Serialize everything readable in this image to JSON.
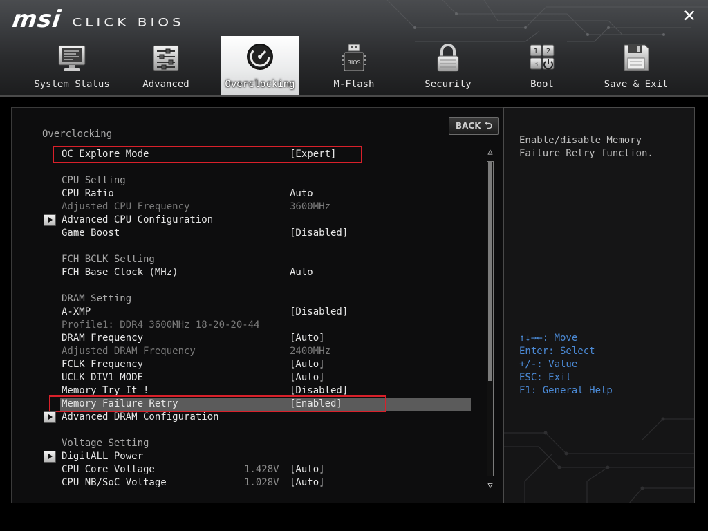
{
  "app": {
    "brand": "msi",
    "product": "CLICK BIOS"
  },
  "close_label": "✕",
  "tabs": [
    {
      "label": "System Status",
      "icon": "monitor-icon"
    },
    {
      "label": "Advanced",
      "icon": "sliders-icon"
    },
    {
      "label": "Overclocking",
      "icon": "gauge-icon",
      "active": true
    },
    {
      "label": "M-Flash",
      "icon": "bios-chip-icon"
    },
    {
      "label": "Security",
      "icon": "padlock-icon"
    },
    {
      "label": "Boot",
      "icon": "boot-order-icon"
    },
    {
      "label": "Save & Exit",
      "icon": "floppy-disk-icon"
    }
  ],
  "main": {
    "title": "Overclocking",
    "back_label": "BACK",
    "rows": {
      "oc_explore_mode": {
        "label": "OC Explore Mode",
        "value": "[Expert]"
      },
      "cpu_setting": {
        "label": "CPU Setting"
      },
      "cpu_ratio": {
        "label": "CPU Ratio",
        "value": "Auto"
      },
      "adjusted_cpu_frequency": {
        "label": "Adjusted CPU Frequency",
        "value": "3600MHz"
      },
      "advanced_cpu_configuration": {
        "label": "Advanced CPU Configuration"
      },
      "game_boost": {
        "label": "Game Boost",
        "value": "[Disabled]"
      },
      "fch_bclk_setting": {
        "label": "FCH BCLK Setting"
      },
      "fch_base_clock": {
        "label": "FCH Base Clock (MHz)",
        "value": "Auto"
      },
      "dram_setting": {
        "label": "DRAM Setting"
      },
      "a_xmp": {
        "label": "A-XMP",
        "value": "[Disabled]"
      },
      "profile1": {
        "label": "Profile1: DDR4 3600MHz 18-20-20-44"
      },
      "dram_frequency": {
        "label": "DRAM Frequency",
        "value": "[Auto]"
      },
      "adjusted_dram_frequency": {
        "label": "Adjusted DRAM Frequency",
        "value": "2400MHz"
      },
      "fclk_frequency": {
        "label": "FCLK Frequency",
        "value": "[Auto]"
      },
      "uclk_div1_mode": {
        "label": "UCLK DIV1 MODE",
        "value": "[Auto]"
      },
      "memory_try_it": {
        "label": "Memory Try It !",
        "value": "[Disabled]"
      },
      "memory_failure_retry": {
        "label": "Memory Failure Retry",
        "value": "[Enabled]"
      },
      "advanced_dram_configuration": {
        "label": "Advanced DRAM Configuration"
      },
      "voltage_setting": {
        "label": "Voltage Setting"
      },
      "digitall_power": {
        "label": "DigitALL Power"
      },
      "cpu_core_voltage": {
        "label": "CPU Core Voltage",
        "reading": "1.428V",
        "value": "[Auto]"
      },
      "cpu_nb_soc_voltage": {
        "label": "CPU NB/SoC Voltage",
        "reading": "1.028V",
        "value": "[Auto]"
      }
    },
    "scrollbar": {
      "position_fraction": 0.0,
      "visible_fraction": 0.7
    }
  },
  "help": {
    "description": "Enable/disable Memory Failure Retry function.",
    "keys": [
      "↑↓→←: Move",
      "Enter: Select",
      "+/-: Value",
      "ESC: Exit",
      "F1: General Help"
    ]
  },
  "colors": {
    "highlight_box": "#d8202a",
    "help_keys": "#4b8ad6",
    "selected_row": "#5b5b5b"
  }
}
